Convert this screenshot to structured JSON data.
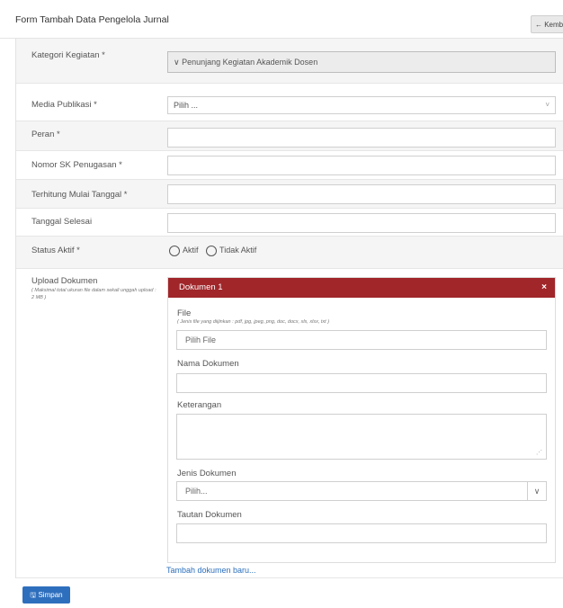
{
  "header": {
    "title": "Form Tambah Data Pengelola Jurnal",
    "back_label": "← Kembali"
  },
  "form": {
    "kategori": {
      "label": "Kategori Kegiatan *",
      "value": "∨ Penunjang Kegiatan Akademik Dosen"
    },
    "media": {
      "label": "Media Publikasi *",
      "value": "Pilih ...",
      "caret": "˅"
    },
    "peran": {
      "label": "Peran *",
      "value": ""
    },
    "nomor_sk": {
      "label": "Nomor SK Penugasan *",
      "value": ""
    },
    "mulai": {
      "label": "Terhitung Mulai Tanggal *",
      "value": ""
    },
    "selesai": {
      "label": "Tanggal Selesai",
      "value": ""
    },
    "status": {
      "label": "Status Aktif *",
      "options": [
        "Aktif",
        "Tidak Aktif"
      ]
    },
    "upload": {
      "label": "Upload Dokumen",
      "note": "( Maksimal total ukuran file dalam sekali unggah upload : 2 MB )"
    }
  },
  "document": {
    "title": "Dokumen 1",
    "close": "×",
    "file_label": "File",
    "file_note": "( Jenis file yang diijinkan : pdf, jpg, jpeg, png, doc, docx, xls, xlsx, txt )",
    "file_button": "Pilih File",
    "nama_label": "Nama Dokumen",
    "keterangan_label": "Keterangan",
    "jenis_label": "Jenis Dokumen",
    "jenis_value": "Pilih...",
    "tautan_label": "Tautan Dokumen"
  },
  "actions": {
    "add_link": "Tambah dokumen baru...",
    "save": "Simpan"
  }
}
